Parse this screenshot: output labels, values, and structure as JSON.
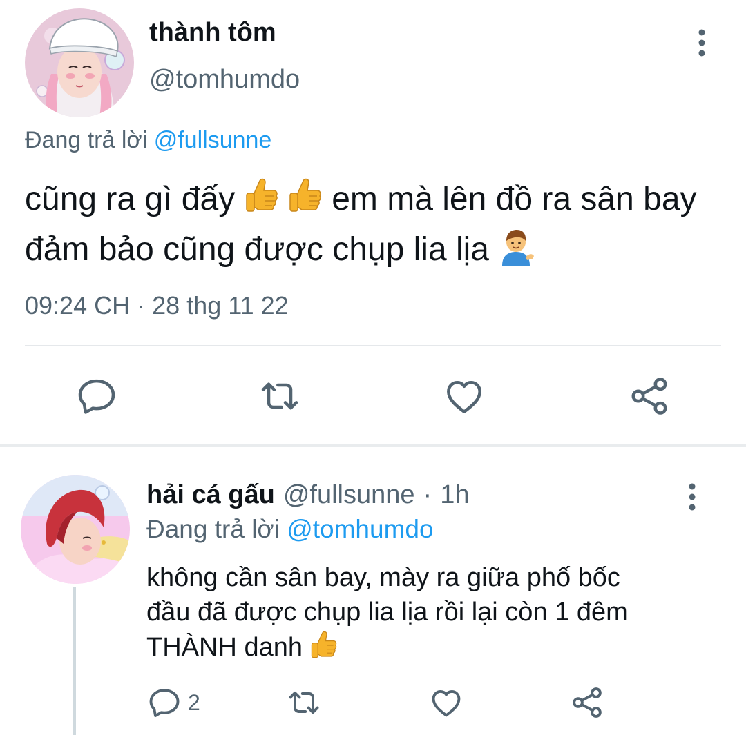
{
  "tweet": {
    "name": "thành tôm",
    "handle": "@tomhumdo",
    "replying_prefix": "Đang trả lời",
    "replying_to": "@fullsunne",
    "text_part1": "cũng ra gì đấy",
    "text_part2": "em mà lên đồ ra sân bay đảm bảo cũng được chụp lia lịa",
    "emoji_1": "thumbs-up",
    "emoji_2": "man-tipping-hand",
    "time": "09:24 CH",
    "separator": "·",
    "date": "28 thg 11 22",
    "icons": {
      "reply": "reply-icon",
      "retweet": "retweet-icon",
      "like": "like-icon",
      "share": "share-icon",
      "more": "more-vertical-icon"
    }
  },
  "reply": {
    "name": "hải cá gấu",
    "handle": "@fullsunne",
    "separator": "·",
    "age": "1h",
    "replying_prefix": "Đang trả lời",
    "replying_to": "@tomhumdo",
    "text_line1": "không cần sân bay, mày ra giữa phố bốc",
    "text_line2": "đầu đã được chụp lia lịa rồi lại còn 1 đêm",
    "text_line3": "THÀNH danh",
    "reply_count": "2"
  },
  "colors": {
    "text": "#0f1419",
    "secondary": "#536471",
    "link": "#1d9bf0",
    "divider": "#e5e8eb"
  }
}
